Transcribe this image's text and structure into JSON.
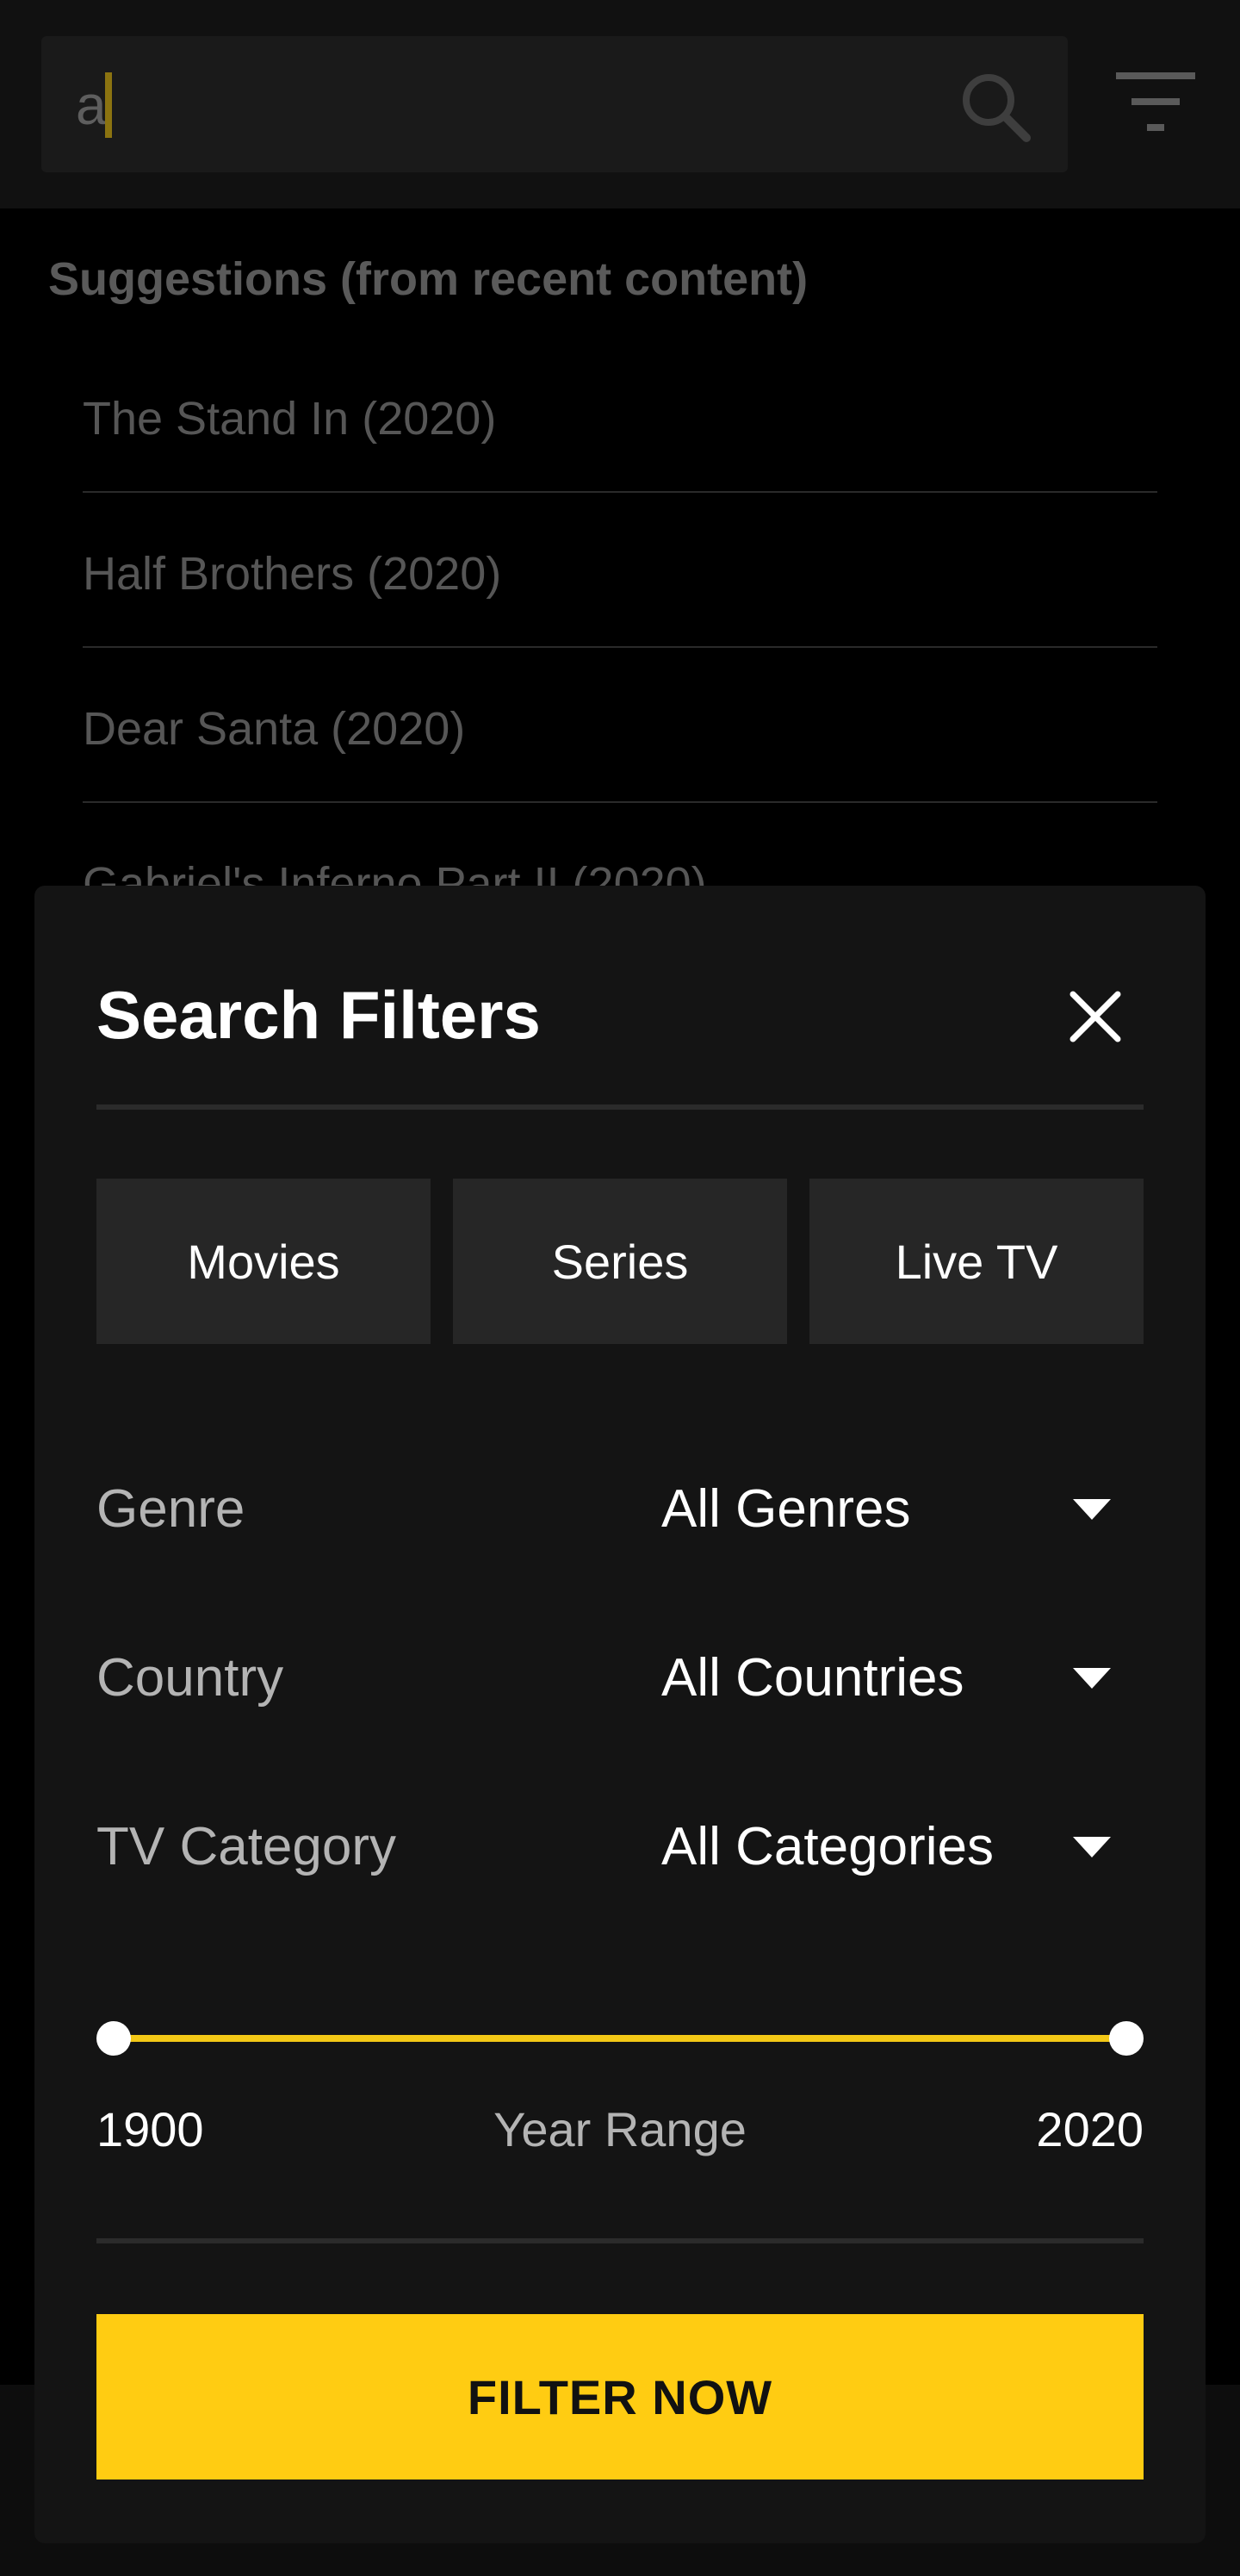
{
  "search": {
    "value": "a",
    "icons": {
      "search": "search-icon",
      "filter": "filter-icon"
    }
  },
  "suggestions": {
    "heading": "Suggestions (from recent content)",
    "items": [
      {
        "label": "The Stand In (2020)"
      },
      {
        "label": "Half Brothers (2020)"
      },
      {
        "label": "Dear Santa (2020)"
      },
      {
        "label": "Gabriel's Inferno Part II (2020)"
      }
    ]
  },
  "modal": {
    "title": "Search Filters",
    "close_icon": "close-icon",
    "types": [
      {
        "label": "Movies"
      },
      {
        "label": "Series"
      },
      {
        "label": "Live TV"
      }
    ],
    "filters": [
      {
        "label": "Genre",
        "value": "All Genres"
      },
      {
        "label": "Country",
        "value": "All Countries"
      },
      {
        "label": "TV Category",
        "value": "All Categories"
      }
    ],
    "year_range": {
      "label": "Year Range",
      "min": "1900",
      "max": "2020"
    },
    "submit_label": "FILTER NOW"
  },
  "colors": {
    "accent": "#ffcc12",
    "background": "#000000",
    "panel": "#141414",
    "button": "#262626"
  }
}
